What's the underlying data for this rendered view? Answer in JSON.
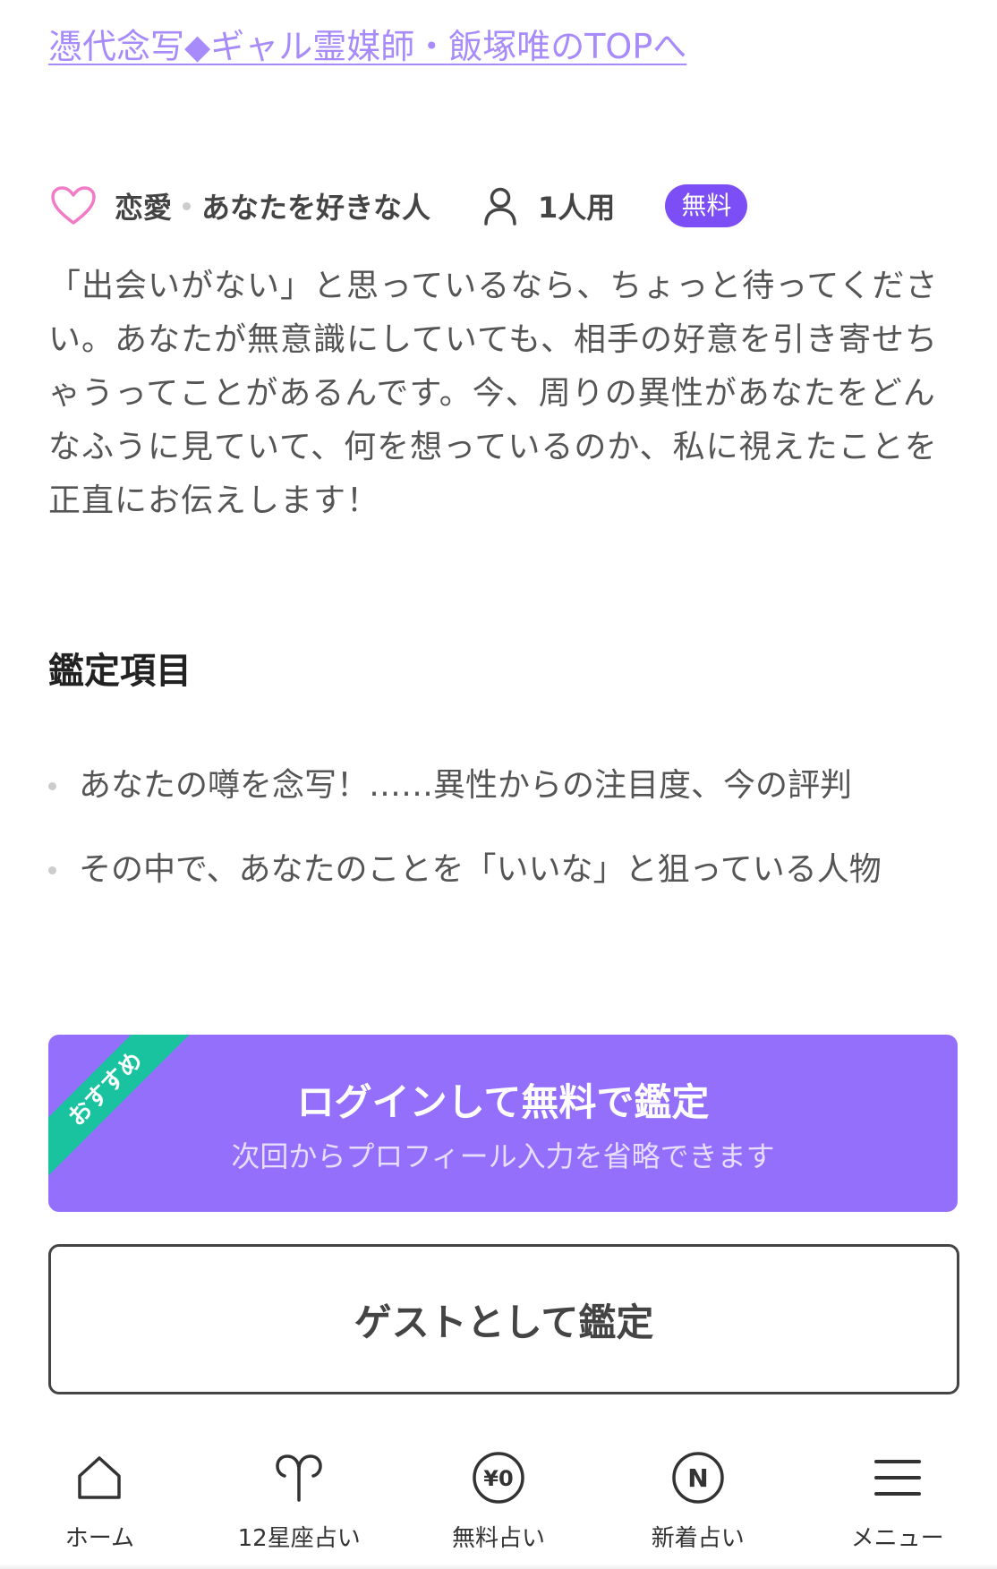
{
  "top_link": {
    "label": "憑代念写◆ギャル霊媒師・飯塚唯のTOPへ"
  },
  "meta": {
    "category": "恋愛",
    "topic": "あなたを好きな人",
    "users": "1人用",
    "price_badge": "無料"
  },
  "description": "「出会いがない」と思っているなら、ちょっと待ってください。あなたが無意識にしていても、相手の好意を引き寄せちゃうってことがあるんです。今、周りの異性があなたをどんなふうに見ていて、何を想っているのか、私に視えたことを正直にお伝えします！",
  "section": {
    "title": "鑑定項目",
    "items": [
      "あなたの噂を念写！……異性からの注目度、今の評判",
      "その中で、あなたのことを「いいな」と狙っている人物"
    ]
  },
  "login_button": {
    "ribbon": "おすすめ",
    "label": "ログインして無料で鑑定",
    "sub": "次回からプロフィール入力を省略できます"
  },
  "guest_button": {
    "label": "ゲストとして鑑定"
  },
  "nav": {
    "items": [
      {
        "label": "ホーム",
        "icon": "home-icon"
      },
      {
        "label": "12星座占い",
        "icon": "aries-icon"
      },
      {
        "label": "無料占い",
        "icon": "yen-zero-icon",
        "icon_text": "¥0"
      },
      {
        "label": "新着占い",
        "icon": "new-icon",
        "icon_text": "N"
      },
      {
        "label": "メニュー",
        "icon": "hamburger-icon"
      }
    ]
  },
  "colors": {
    "link": "#a78bfa",
    "accent": "#7c4ef5",
    "login_bg": "#946ffb",
    "ribbon": "#19c3a0",
    "heart": "#f27bc8"
  }
}
